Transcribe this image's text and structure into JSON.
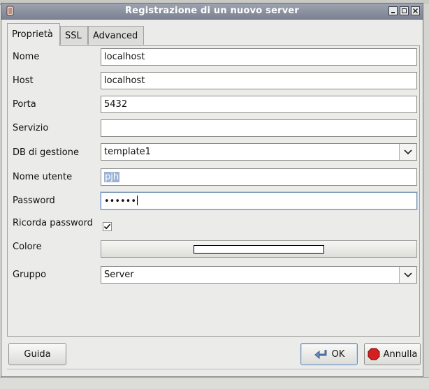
{
  "window": {
    "title": "Registrazione di un nuovo server"
  },
  "tabs": [
    {
      "label": "Proprietà",
      "active": true
    },
    {
      "label": "SSL",
      "active": false
    },
    {
      "label": "Advanced",
      "active": false
    }
  ],
  "form": {
    "nome": {
      "label": "Nome",
      "value": "localhost"
    },
    "host": {
      "label": "Host",
      "value": "localhost"
    },
    "porta": {
      "label": "Porta",
      "value": "5432"
    },
    "servizio": {
      "label": "Servizio",
      "value": ""
    },
    "db": {
      "label": "DB di gestione",
      "value": "template1"
    },
    "utente": {
      "label": "Nome utente",
      "value": "pjh"
    },
    "password": {
      "label": "Password",
      "value": "••••••"
    },
    "ricorda": {
      "label": "Ricorda password",
      "checked": true
    },
    "colore": {
      "label": "Colore"
    },
    "gruppo": {
      "label": "Gruppo",
      "value": "Server"
    }
  },
  "buttons": {
    "help": "Guida",
    "ok": "OK",
    "cancel": "Annulla"
  },
  "colors": {
    "titlebar": "#8a8f9d",
    "selection": "#9ab3d6",
    "focus": "#6f8fb3"
  }
}
